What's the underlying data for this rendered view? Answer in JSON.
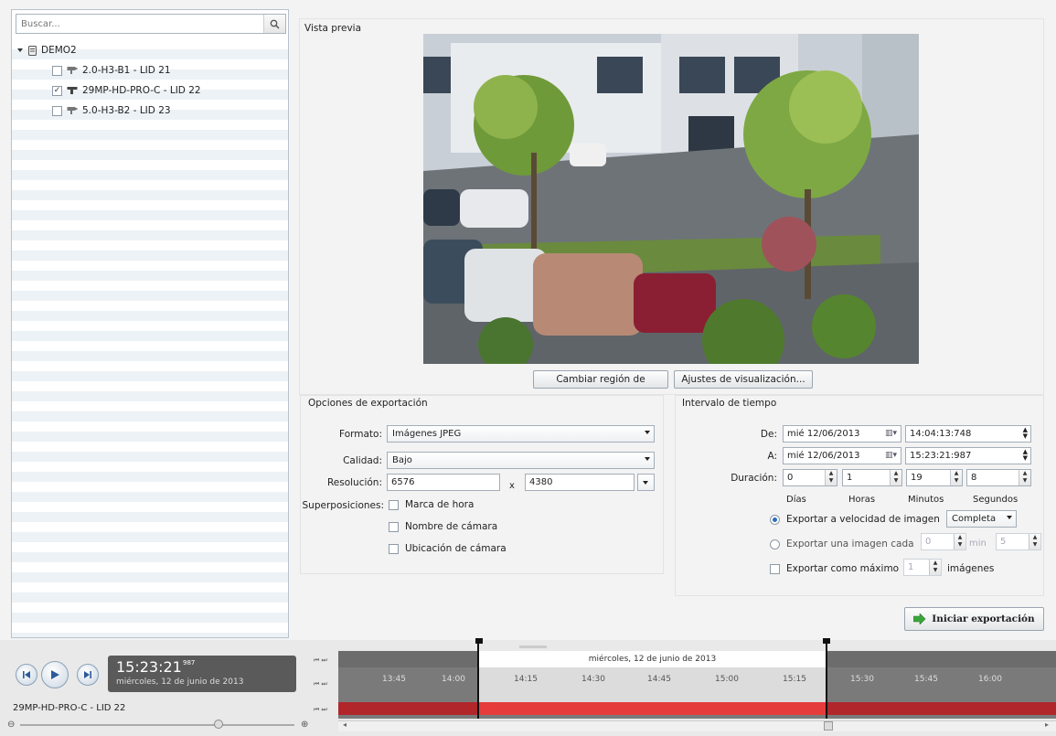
{
  "search": {
    "placeholder": "Buscar..."
  },
  "tree": {
    "root": "DEMO2",
    "items": [
      {
        "label": "2.0-H3-B1 - LID 21",
        "checked": false
      },
      {
        "label": "29MP-HD-PRO-C - LID 22",
        "checked": true
      },
      {
        "label": "5.0-H3-B2 - LID 23",
        "checked": false
      }
    ]
  },
  "preview": {
    "title": "Vista previa",
    "btn_region": "Cambiar región de",
    "btn_display": "Ajustes de visualización..."
  },
  "export_options": {
    "title": "Opciones de exportación",
    "format_label": "Formato:",
    "format_value": "Imágenes JPEG",
    "quality_label": "Calidad:",
    "quality_value": "Bajo",
    "resolution_label": "Resolución:",
    "res_width": "6576",
    "res_x": "x",
    "res_height": "4380",
    "overlays_label": "Superposiciones:",
    "overlays": [
      {
        "label": "Marca de hora",
        "checked": false
      },
      {
        "label": "Nombre de cámara",
        "checked": false
      },
      {
        "label": "Ubicación de cámara",
        "checked": false
      }
    ]
  },
  "interval": {
    "title": "Intervalo de tiempo",
    "from_label": "De:",
    "from_date": "mié 12/06/2013",
    "from_time": "14:04:13:748",
    "to_label": "A:",
    "to_date": "mié 12/06/2013",
    "to_time": "15:23:21:987",
    "duration_label": "Duración:",
    "days": "0",
    "hours": "1",
    "minutes": "19",
    "seconds": "8",
    "days_label": "Días",
    "hours_label": "Horas",
    "minutes_label": "Minutos",
    "seconds_label": "Segundos",
    "opt_rate": "Exportar a velocidad de imagen",
    "rate_value": "Completa",
    "opt_every": "Exportar una imagen cada",
    "every_min": "0",
    "min_label": "min",
    "every_sec": "5",
    "opt_max": "Exportar como máximo",
    "max_value": "1",
    "images_label": "imágenes"
  },
  "start_export": "Iniciar exportación",
  "player": {
    "time": "15:23:21",
    "ms": "987",
    "date": "miércoles, 12 de junio de 2013",
    "camera": "29MP-HD-PRO-C - LID 22"
  },
  "timeline": {
    "date": "miércoles, 12 de junio de 2013",
    "ticks": [
      "13:45",
      "14:00",
      "14:15",
      "14:30",
      "14:45",
      "15:00",
      "15:15",
      "15:30",
      "15:45",
      "16:00"
    ]
  },
  "colors": {
    "accent": "#2a6cc4",
    "timeline_red": "#c8262a",
    "start_icon": "#3aa63a"
  }
}
